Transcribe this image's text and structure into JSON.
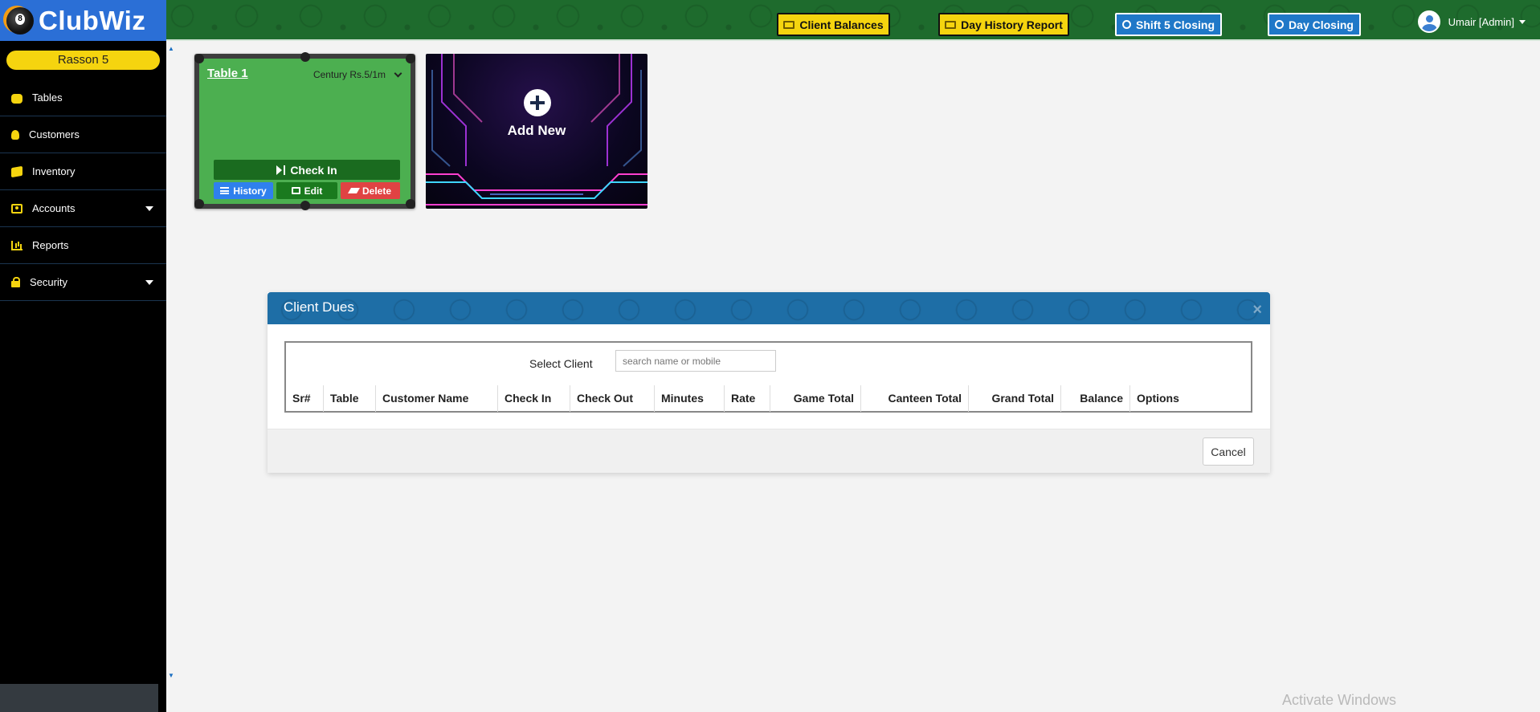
{
  "brand": {
    "name": "ClubWiz"
  },
  "club": {
    "name": "Rasson 5"
  },
  "sidebar": {
    "items": [
      {
        "label": "Tables",
        "icon": "gamepad-icon",
        "has_caret": false
      },
      {
        "label": "Customers",
        "icon": "users-icon",
        "has_caret": false
      },
      {
        "label": "Inventory",
        "icon": "box-icon",
        "has_caret": false
      },
      {
        "label": "Accounts",
        "icon": "money-icon",
        "has_caret": true
      },
      {
        "label": "Reports",
        "icon": "chart-icon",
        "has_caret": false
      },
      {
        "label": "Security",
        "icon": "lock-icon",
        "has_caret": true
      }
    ]
  },
  "topbar": {
    "client_balances": "Client Balances",
    "day_history_report": "Day History Report",
    "shift_closing": "Shift 5 Closing",
    "day_closing": "Day Closing",
    "user": "Umair [Admin]"
  },
  "tables": [
    {
      "name": "Table 1",
      "rate": "Century Rs.5/1m",
      "checkin_label": "Check In",
      "history_label": "History",
      "edit_label": "Edit",
      "delete_label": "Delete"
    }
  ],
  "add_new": {
    "label": "Add New"
  },
  "modal": {
    "title": "Client Dues",
    "close_symbol": "×",
    "select_client_label": "Select Client",
    "search_placeholder": "search name or mobile",
    "columns": [
      "Sr#",
      "Table",
      "Customer Name",
      "Check In",
      "Check Out",
      "Minutes",
      "Rate",
      "Game Total",
      "Canteen Total",
      "Grand Total",
      "Balance",
      "Options"
    ],
    "cancel_label": "Cancel"
  },
  "watermark": "Activate Windows",
  "colors": {
    "sidebar_bg": "#000000",
    "brand_blue": "#2b6fd6",
    "topbar_green": "#1e6b2d",
    "accent_yellow": "#f5d40f",
    "table_felt": "#4caf50",
    "modal_header": "#1e6ea6"
  }
}
